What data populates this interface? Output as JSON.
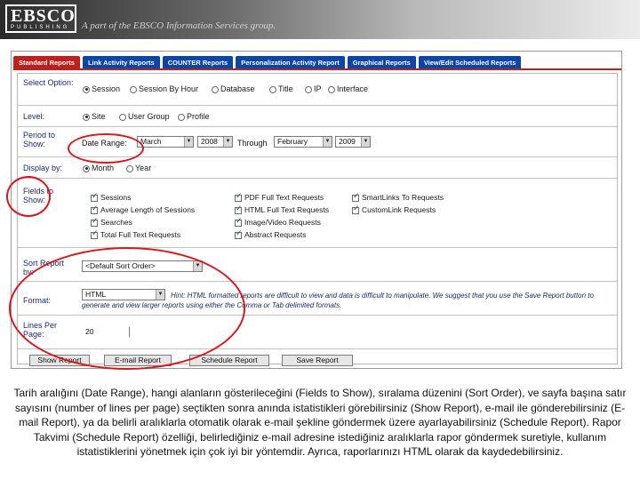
{
  "header": {
    "logo": "EBSCO",
    "logo_sub": "PUBLISHING",
    "tagline": "A part of the EBSCO Information Services group."
  },
  "tabs": [
    {
      "label": "Standard Reports",
      "active": true
    },
    {
      "label": "Link Activity Reports",
      "active": false
    },
    {
      "label": "COUNTER Reports",
      "active": false
    },
    {
      "label": "Personalization Activity Report",
      "active": false
    },
    {
      "label": "Graphical Reports",
      "active": false
    },
    {
      "label": "View/Edit Scheduled Reports",
      "active": false
    }
  ],
  "form": {
    "select_option": {
      "label": "Select Option:",
      "options": [
        "Session",
        "Session By Hour",
        "Database",
        "Title",
        "IP",
        "Interface"
      ],
      "selected": "Session"
    },
    "level": {
      "label": "Level:",
      "options": [
        "Site",
        "User Group",
        "Profile"
      ],
      "selected": "Site"
    },
    "period": {
      "label": "Period to Show:",
      "date_range_label": "Date Range:",
      "from_month": "March",
      "from_year": "2008",
      "through_label": "Through",
      "to_month": "February",
      "to_year": "2009"
    },
    "display_by": {
      "label": "Display by:",
      "options": [
        "Month",
        "Year"
      ],
      "selected": "Month"
    },
    "fields": {
      "label": "Fields to Show:",
      "items": [
        "Sessions",
        "PDF Full Text Requests",
        "SmartLinks To Requests",
        "Average Length of Sessions",
        "HTML Full Text Requests",
        "CustomLink Requests",
        "Searches",
        "Image/Video Requests",
        "Total Full Text Requests",
        "Abstract Requests"
      ]
    },
    "sort": {
      "label": "Sort Report by:",
      "value": "<Default Sort Order>"
    },
    "format": {
      "label": "Format:",
      "value": "HTML",
      "hint": "Hint: HTML formatted reports are difficult to view and data is difficult to manipulate. We suggest that you use the Save Report button to generate and view larger reports using either the Comma or Tab delimited formats."
    },
    "lines": {
      "label": "Lines Per Page:",
      "value": "20"
    }
  },
  "buttons": {
    "show": "Show Report",
    "email": "E-mail Report",
    "schedule": "Schedule Report",
    "save": "Save Report"
  },
  "caption": {
    "text": "Tarih aralığını (Date Range), hangi alanların gösterileceğini (Fields to Show), sıralama düzenini (Sort Order), ve sayfa başına satır sayısını (number of lines per page) seçtikten sonra anında istatistikleri görebilirsiniz (Show Report), e-mail ile gönderebilirsiniz (E-mail Report), ya da belirli aralıklarla otomatik olarak e-mail şekline göndermek üzere ayarlayabilirsiniz (Schedule Report). Rapor Takvimi (Schedule Report) özelliği, belirlediğiniz e-mail adresine istediğiniz aralıklarla rapor göndermek suretiyle, kullanım istatistiklerini yönetmek için çok iyi bir yöntemdir. Ayrıca, raporlarınızı HTML olarak da kaydedebilirsiniz."
  },
  "colors": {
    "tab_blue": "#0a45a8",
    "tab_active_red": "#c0201c",
    "annotation_red": "#d6171b"
  }
}
